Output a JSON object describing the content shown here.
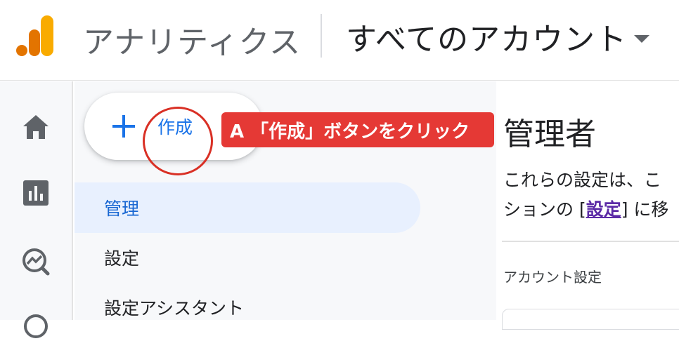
{
  "header": {
    "product_name": "アナリティクス",
    "account_selector": "すべてのアカウント",
    "logo_colors": [
      "#F9AB00",
      "#E37400"
    ]
  },
  "rail": {
    "items": [
      {
        "icon": "home-icon"
      },
      {
        "icon": "reports-icon"
      },
      {
        "icon": "explore-icon"
      },
      {
        "icon": "advertising-icon"
      }
    ]
  },
  "create_button": {
    "icon": "plus-icon",
    "label": "作成"
  },
  "annotation": {
    "callout": "A 「作成」ボタンをクリック",
    "color": "#E53935"
  },
  "sidenav": {
    "items": [
      {
        "label": "管理",
        "active": true
      },
      {
        "label": "設定",
        "active": false
      },
      {
        "label": "設定アシスタント",
        "active": false
      }
    ]
  },
  "main": {
    "title": "管理者",
    "description_line1": "これらの設定は、こ",
    "description_line2_prefix": "ションの [",
    "description_link": "設定",
    "description_line2_suffix": "] に移",
    "section_label": "アカウント設定"
  },
  "colors": {
    "accent": "#1A73E8",
    "active_nav_bg": "#E8F0FE",
    "link": "#5B2AA6",
    "annotation_red": "#D93025"
  }
}
